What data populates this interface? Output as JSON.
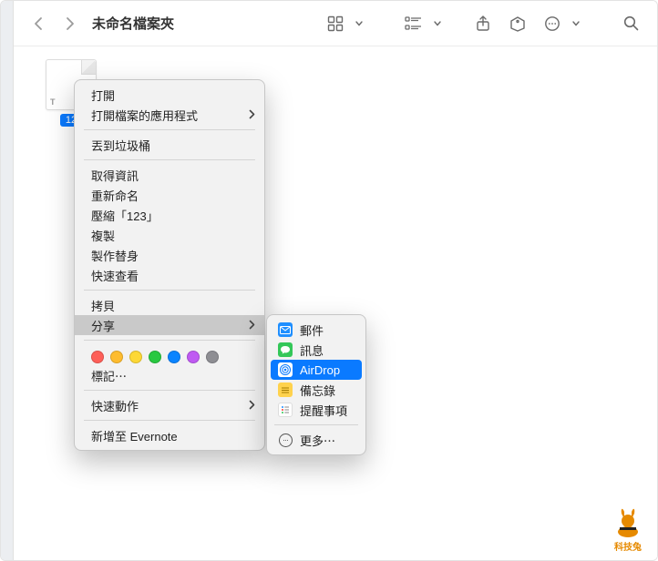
{
  "window": {
    "title": "未命名檔案夾"
  },
  "file": {
    "ext_label": "T",
    "badge": "12"
  },
  "context_menu": {
    "open": "打開",
    "open_with": "打開檔案的應用程式",
    "trash": "丟到垃圾桶",
    "get_info": "取得資訊",
    "rename": "重新命名",
    "compress": "壓縮「123」",
    "duplicate": "複製",
    "make_alias": "製作替身",
    "quick_look": "快速查看",
    "copy": "拷貝",
    "share": "分享",
    "tags_label": "標記⋯",
    "quick_actions": "快速動作",
    "add_to_evernote": "新增至 Evernote"
  },
  "tag_colors": [
    "#fe5f58",
    "#febc2e",
    "#fdd835",
    "#28c840",
    "#0a84ff",
    "#bf5af2",
    "#8e8e93"
  ],
  "share_submenu": {
    "mail": "郵件",
    "messages": "訊息",
    "airdrop": "AirDrop",
    "notes": "備忘錄",
    "reminders": "提醒事項",
    "more": "更多⋯"
  },
  "icon_colors": {
    "mail": "#1f8fff",
    "messages": "#34c759",
    "airdrop": "#ffffff",
    "notes": "#ffd24d",
    "reminders": "#ffffff"
  },
  "watermark": "科技兔"
}
